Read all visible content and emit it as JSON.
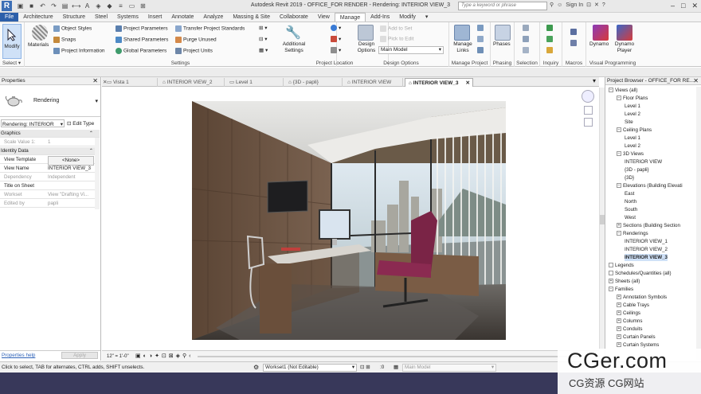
{
  "titlebar": {
    "app_title": "Autodesk Revit 2019 - OFFICE_FOR RENDER - Rendering: INTERIOR VIEW_3",
    "search_placeholder": "Type a keyword or phrase",
    "sign_in": "Sign In"
  },
  "tabs": [
    "File",
    "Architecture",
    "Structure",
    "Steel",
    "Systems",
    "Insert",
    "Annotate",
    "Analyze",
    "Massing & Site",
    "Collaborate",
    "View",
    "Manage",
    "Add-Ins",
    "Modify"
  ],
  "active_tab": "Manage",
  "ribbon": {
    "select_group": {
      "modify": "Modify",
      "label": "Select ▾"
    },
    "settings_group": {
      "materials": "Materials",
      "object_styles": "Object  Styles",
      "snaps": "Snaps",
      "project_information": "Project  Information",
      "project_parameters": "Project  Parameters",
      "shared_parameters": "Shared  Parameters",
      "global_parameters": "Global  Parameters",
      "transfer_project_standards": "Transfer  Project Standards",
      "purge_unused": "Purge  Unused",
      "project_units": "Project  Units",
      "additional_settings": "Additional Settings",
      "label": "Settings"
    },
    "project_location_group": {
      "label": "Project Location"
    },
    "design_options_group": {
      "design_options": "Design Options",
      "add_to_set": "Add to Set",
      "pick_to_edit": "Pick to Edit",
      "main_model": "Main Model",
      "label": "Design Options"
    },
    "manage_project_group": {
      "manage_links": "Manage Links",
      "label": "Manage Project"
    },
    "phasing_group": {
      "phases": "Phases",
      "label": "Phasing"
    },
    "selection_group": {
      "label": "Selection"
    },
    "inquiry_group": {
      "label": "Inquiry"
    },
    "macros_group": {
      "label": "Macros"
    },
    "visual_programming_group": {
      "dynamo": "Dynamo",
      "dynamo_player": "Dynamo Player",
      "label": "Visual Programming"
    }
  },
  "properties": {
    "title": "Properties",
    "type_name": "Rendering",
    "instance_selector": "Rendering: INTERIOR",
    "edit_type": "Edit Type",
    "rows": [
      {
        "section": true,
        "key": "Graphics",
        "value": ""
      },
      {
        "key": "Scale Value  1:",
        "value": "1",
        "dim": true
      },
      {
        "section": true,
        "key": "Identity Data",
        "value": ""
      },
      {
        "key": "View Template",
        "value": "<None>"
      },
      {
        "key": "View Name",
        "value": "INTERIOR VIEW_3"
      },
      {
        "key": "Dependency",
        "value": "Independent",
        "dim": true
      },
      {
        "key": "Title on Sheet",
        "value": ""
      },
      {
        "key": "Workset",
        "value": "View \"Drafting Vi...",
        "dim": true
      },
      {
        "key": "Edited by",
        "value": "papli",
        "dim": true
      }
    ],
    "help_link": "Properties help",
    "apply": "Apply"
  },
  "doc_tabs": [
    "Vista 1",
    "INTERIOR VIEW_2",
    "Level 1",
    "{3D - papli}",
    "INTERIOR VIEW",
    "INTERIOR VIEW_3"
  ],
  "active_doc_tab": "INTERIOR VIEW_3",
  "view_control": {
    "scale": "12\" = 1'-0\""
  },
  "project_browser": {
    "title": "Project Browser - OFFICE_FOR RE...",
    "nodes": [
      {
        "level": 0,
        "label": "Views (all)",
        "toggle": "−"
      },
      {
        "level": 1,
        "label": "Floor Plans",
        "toggle": "−"
      },
      {
        "level": 2,
        "label": "Level 1"
      },
      {
        "level": 2,
        "label": "Level 2"
      },
      {
        "level": 2,
        "label": "Site"
      },
      {
        "level": 1,
        "label": "Ceiling Plans",
        "toggle": "−"
      },
      {
        "level": 2,
        "label": "Level 1"
      },
      {
        "level": 2,
        "label": "Level 2"
      },
      {
        "level": 1,
        "label": "3D Views",
        "toggle": "−"
      },
      {
        "level": 2,
        "label": "INTERIOR VIEW"
      },
      {
        "level": 2,
        "label": "{3D - papli}"
      },
      {
        "level": 2,
        "label": "{3D}"
      },
      {
        "level": 1,
        "label": "Elevations (Building Elevati",
        "toggle": "−"
      },
      {
        "level": 2,
        "label": "East"
      },
      {
        "level": 2,
        "label": "North"
      },
      {
        "level": 2,
        "label": "South"
      },
      {
        "level": 2,
        "label": "West"
      },
      {
        "level": 1,
        "label": "Sections (Building Section",
        "toggle": "+"
      },
      {
        "level": 1,
        "label": "Renderings",
        "toggle": "−"
      },
      {
        "level": 2,
        "label": "INTERIOR VIEW_1"
      },
      {
        "level": 2,
        "label": "INTERIOR VIEW_2"
      },
      {
        "level": 2,
        "label": "INTERIOR VIEW_3",
        "selected": true
      },
      {
        "level": 0,
        "label": "Legends",
        "toggle": ""
      },
      {
        "level": 0,
        "label": "Schedules/Quantities (all)",
        "toggle": ""
      },
      {
        "level": 0,
        "label": "Sheets (all)",
        "toggle": "+"
      },
      {
        "level": 0,
        "label": "Families",
        "toggle": "−"
      },
      {
        "level": 1,
        "label": "Annotation Symbols",
        "toggle": "+"
      },
      {
        "level": 1,
        "label": "Cable Trays",
        "toggle": "+"
      },
      {
        "level": 1,
        "label": "Ceilings",
        "toggle": "+"
      },
      {
        "level": 1,
        "label": "Columns",
        "toggle": "+"
      },
      {
        "level": 1,
        "label": "Conduits",
        "toggle": "+"
      },
      {
        "level": 1,
        "label": "Curtain Panels",
        "toggle": "+"
      },
      {
        "level": 1,
        "label": "Curtain Systems",
        "toggle": "+"
      }
    ]
  },
  "statusbar": {
    "hint": "Click to select, TAB for alternates, CTRL adds, SHIFT unselects.",
    "workset": "Workset1 (Not Editable)",
    "model": "Main Model",
    "zero": ":0"
  },
  "watermark": {
    "big": "CGer.com",
    "small": "CG资源  CG网站"
  }
}
